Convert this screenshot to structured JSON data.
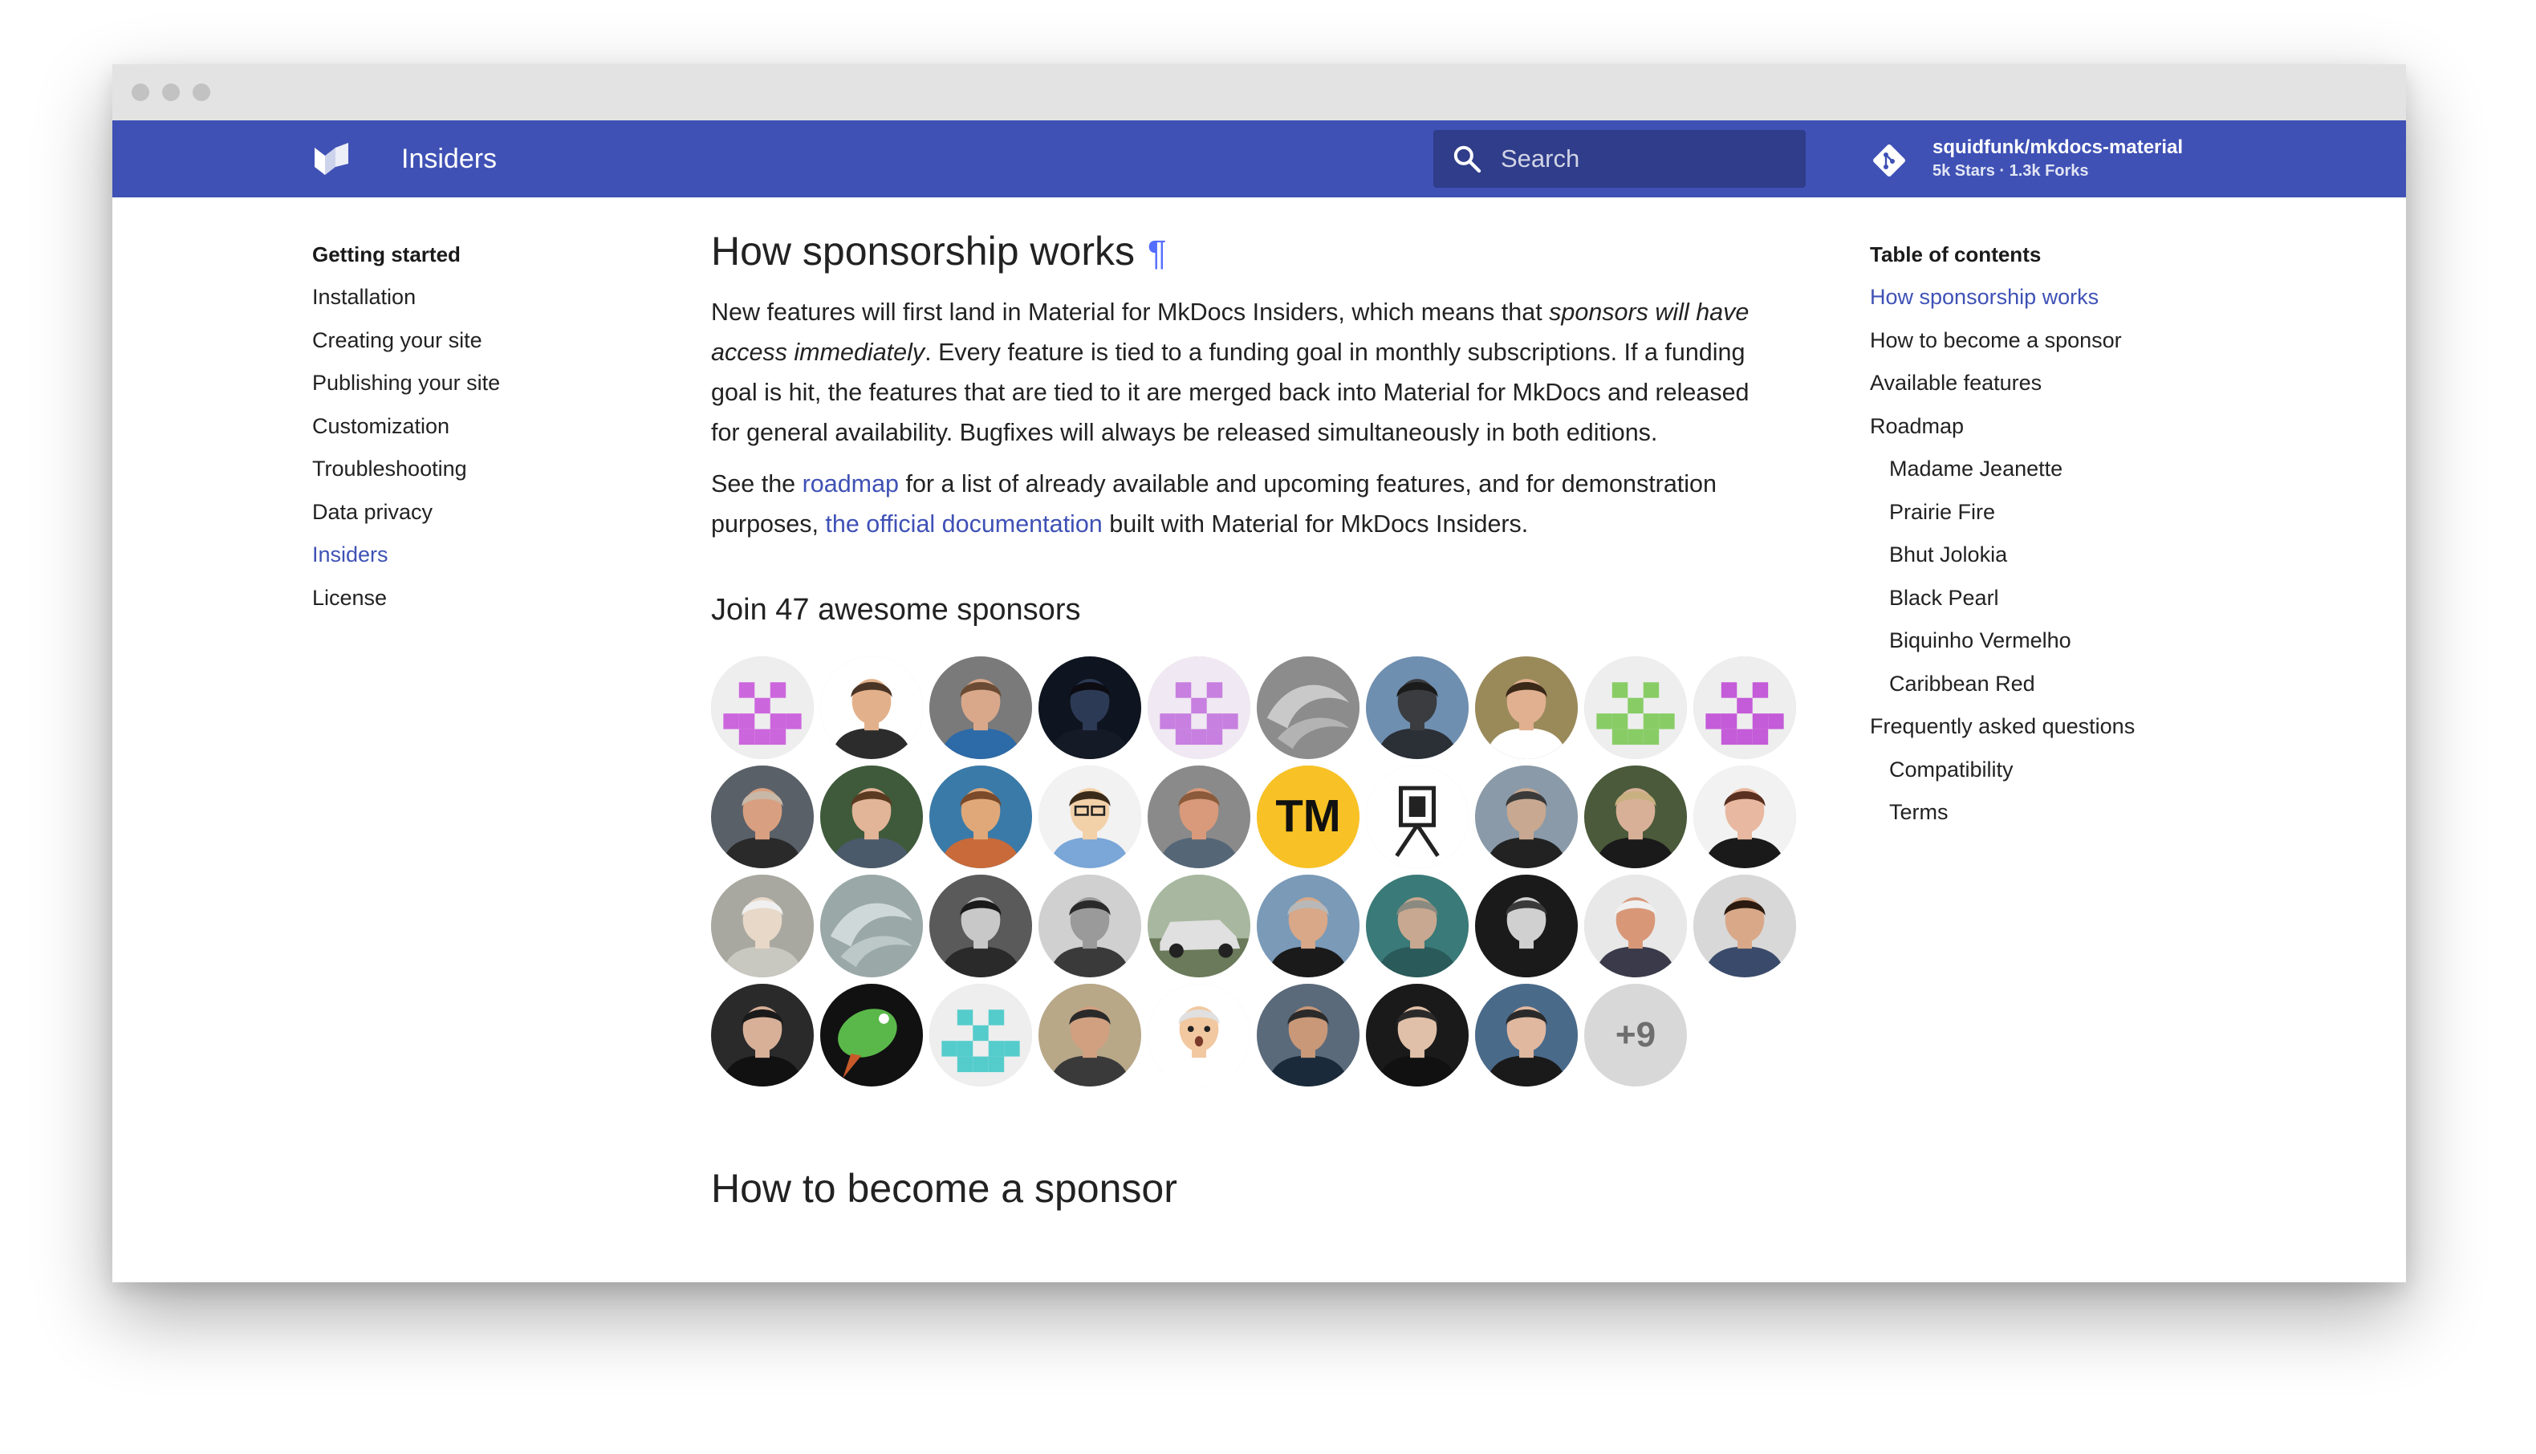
{
  "header": {
    "site_title": "Insiders",
    "search_placeholder": "Search",
    "repo_name": "squidfunk/mkdocs-material",
    "repo_stats": "5k Stars · 1.3k Forks",
    "color": "#3f51b5"
  },
  "sidebar": {
    "title": "Getting started",
    "items": [
      {
        "label": "Installation",
        "active": false
      },
      {
        "label": "Creating your site",
        "active": false
      },
      {
        "label": "Publishing your site",
        "active": false
      },
      {
        "label": "Customization",
        "active": false
      },
      {
        "label": "Troubleshooting",
        "active": false
      },
      {
        "label": "Data privacy",
        "active": false
      },
      {
        "label": "Insiders",
        "active": true
      },
      {
        "label": "License",
        "active": false
      }
    ]
  },
  "content": {
    "heading": "How sponsorship works",
    "headerlink": "¶",
    "paragraph1": {
      "line1_a": "New features will first land in Material for MkDocs Insiders, which means that ",
      "line1_em": "sponsors will have",
      "line2_em": "access immediately",
      "line2_b": ". Every feature is tied to a funding goal in monthly subscriptions. If a funding",
      "line3": "goal is hit, the features that are tied to it are merged back into Material for MkDocs and released",
      "line4": "for general availability. Bugfixes will always be released simultaneously in both editions."
    },
    "paragraph2": {
      "line1_a": "See the ",
      "link_roadmap": "roadmap",
      "line1_b": " for a list of already available and upcoming features, and for demonstration",
      "line2_a": "purposes, ",
      "link_docs": "the official documentation",
      "line2_b": " built with Material for MkDocs Insiders."
    },
    "sponsors_heading": "Join 47 awesome sponsors",
    "sponsors_more": "+9",
    "next_heading": "How to become a sponsor"
  },
  "sponsors": [
    {
      "name": "sponsor-1",
      "kind": "pixel",
      "bg": "#eeeeee",
      "fg": "#cc66dd"
    },
    {
      "name": "sponsor-2",
      "kind": "person",
      "bg": "#ffffff",
      "skin": "#e2b08a",
      "hair": "#4a3425",
      "shirt": "#2c2c2c"
    },
    {
      "name": "sponsor-3",
      "kind": "person",
      "bg": "#7a7a7a",
      "skin": "#d9a88a",
      "hair": "#6b4b33",
      "shirt": "#2d6aa8"
    },
    {
      "name": "sponsor-4",
      "kind": "person",
      "bg": "#0f1520",
      "skin": "#2d3a55",
      "hair": "#0c0c12",
      "shirt": "#141a26"
    },
    {
      "name": "sponsor-5",
      "kind": "pixel",
      "bg": "#f0e8f2",
      "fg": "#c77fe0"
    },
    {
      "name": "sponsor-6",
      "kind": "swirl",
      "bg": "#8c8c8c",
      "fg": "#d4d4d4"
    },
    {
      "name": "sponsor-7",
      "kind": "person",
      "bg": "#6f8fb0",
      "skin": "#3a3c40",
      "hair": "#1b1b1b",
      "shirt": "#2b2f36"
    },
    {
      "name": "sponsor-8",
      "kind": "person",
      "bg": "#9a8a5a",
      "skin": "#e0b090",
      "hair": "#3a2818",
      "shirt": "#ffffff"
    },
    {
      "name": "sponsor-9",
      "kind": "pixel",
      "bg": "#eeeeee",
      "fg": "#88cc66"
    },
    {
      "name": "sponsor-10",
      "kind": "pixel",
      "bg": "#eeeeee",
      "fg": "#c45bd8"
    },
    {
      "name": "sponsor-11",
      "kind": "person",
      "bg": "#5a6068",
      "skin": "#d8a080",
      "hair": "#c8b8a8",
      "shirt": "#2a2a2a"
    },
    {
      "name": "sponsor-12",
      "kind": "person",
      "bg": "#3e5a3a",
      "skin": "#e2b498",
      "hair": "#5a3a20",
      "shirt": "#4a5a6a"
    },
    {
      "name": "sponsor-13",
      "kind": "person",
      "bg": "#3a7aa8",
      "skin": "#e0a878",
      "hair": "#7a4a2a",
      "shirt": "#c86a3a"
    },
    {
      "name": "sponsor-14",
      "kind": "cartoon",
      "bg": "#f2f2f2",
      "skin": "#f2d0a8",
      "hair": "#3a2a1a",
      "shirt": "#7aa6d8"
    },
    {
      "name": "sponsor-15",
      "kind": "person",
      "bg": "#8a8a8a",
      "skin": "#d89a7a",
      "hair": "#8a5a3a",
      "shirt": "#556677"
    },
    {
      "name": "sponsor-16",
      "kind": "tm",
      "bg": "#f8c226",
      "fg": "#111111",
      "text": "TM"
    },
    {
      "name": "sponsor-17",
      "kind": "easel",
      "bg": "#ffffff",
      "fg": "#222222"
    },
    {
      "name": "sponsor-18",
      "kind": "person",
      "bg": "#8a9aa8",
      "skin": "#c8a890",
      "hair": "#3a3a3a",
      "shirt": "#222222"
    },
    {
      "name": "sponsor-19",
      "kind": "person",
      "bg": "#4a5a3a",
      "skin": "#d8b098",
      "hair": "#c8b080",
      "shirt": "#1a1a1a"
    },
    {
      "name": "sponsor-20",
      "kind": "person",
      "bg": "#f2f2f2",
      "skin": "#e8b8a0",
      "hair": "#5a3020",
      "shirt": "#1a1a1a"
    },
    {
      "name": "sponsor-21",
      "kind": "person",
      "bg": "#a8a8a0",
      "skin": "#e8d8c8",
      "hair": "#f0f0f0",
      "shirt": "#c8c8c0"
    },
    {
      "name": "sponsor-22",
      "kind": "swirl",
      "bg": "#9aa8a8",
      "fg": "#d8e0e0"
    },
    {
      "name": "sponsor-23",
      "kind": "person",
      "bg": "#5a5a5a",
      "skin": "#c8c8c8",
      "hair": "#1a1a1a",
      "shirt": "#2a2a2a"
    },
    {
      "name": "sponsor-24",
      "kind": "person",
      "bg": "#d0d0d0",
      "skin": "#9a9a9a",
      "hair": "#2a2a2a",
      "shirt": "#3a3a3a"
    },
    {
      "name": "sponsor-25",
      "kind": "car",
      "bg": "#a8b8a0",
      "fg": "#e0e0e0"
    },
    {
      "name": "sponsor-26",
      "kind": "person",
      "bg": "#7a9ab8",
      "skin": "#d8a888",
      "hair": "#b8b8b8",
      "shirt": "#1a1a1a"
    },
    {
      "name": "sponsor-27",
      "kind": "person",
      "bg": "#3a7a78",
      "skin": "#c8a890",
      "hair": "#8a8a80",
      "shirt": "#2a5a5a"
    },
    {
      "name": "sponsor-28",
      "kind": "person",
      "bg": "#1a1a1a",
      "skin": "#d0d0d0",
      "hair": "#3a3a3a",
      "shirt": "#1a1a1a"
    },
    {
      "name": "sponsor-29",
      "kind": "person",
      "bg": "#e8e8e8",
      "skin": "#d89878",
      "hair": "#f0f0f0",
      "shirt": "#3a3a4a"
    },
    {
      "name": "sponsor-30",
      "kind": "person",
      "bg": "#d8d8d8",
      "skin": "#d8a888",
      "hair": "#2a1a10",
      "shirt": "#3a4a6a"
    },
    {
      "name": "sponsor-31",
      "kind": "person",
      "bg": "#2a2a2a",
      "skin": "#d8b098",
      "hair": "#1a1a1a",
      "shirt": "#111111"
    },
    {
      "name": "sponsor-32",
      "kind": "bird",
      "bg": "#111111",
      "fg": "#5ab84a"
    },
    {
      "name": "sponsor-33",
      "kind": "pixel",
      "bg": "#eeeeee",
      "fg": "#55cccc"
    },
    {
      "name": "sponsor-34",
      "kind": "person",
      "bg": "#b8a888",
      "skin": "#d0a080",
      "hair": "#2a2a2a",
      "shirt": "#3a3a3a"
    },
    {
      "name": "sponsor-35",
      "kind": "emoji",
      "bg": "#ffffff",
      "skin": "#f2c8a0",
      "hair": "#e0e0e0",
      "shirt": "#ffffff"
    },
    {
      "name": "sponsor-36",
      "kind": "person",
      "bg": "#5a6a7a",
      "skin": "#c89878",
      "hair": "#2a2a2a",
      "shirt": "#1a2a3a"
    },
    {
      "name": "sponsor-37",
      "kind": "person",
      "bg": "#1a1a1a",
      "skin": "#e0c0a8",
      "hair": "#2a2a2a",
      "shirt": "#111111"
    },
    {
      "name": "sponsor-38",
      "kind": "person",
      "bg": "#4a6a8a",
      "skin": "#e0b8a0",
      "hair": "#2a2a2a",
      "shirt": "#1a1a1a"
    }
  ],
  "toc": {
    "title": "Table of contents",
    "items": [
      {
        "label": "How sponsorship works",
        "level": 1,
        "active": true
      },
      {
        "label": "How to become a sponsor",
        "level": 1,
        "active": false
      },
      {
        "label": "Available features",
        "level": 1,
        "active": false
      },
      {
        "label": "Roadmap",
        "level": 1,
        "active": false
      },
      {
        "label": "Madame Jeanette",
        "level": 2,
        "active": false
      },
      {
        "label": "Prairie Fire",
        "level": 2,
        "active": false
      },
      {
        "label": "Bhut Jolokia",
        "level": 2,
        "active": false
      },
      {
        "label": "Black Pearl",
        "level": 2,
        "active": false
      },
      {
        "label": "Biquinho Vermelho",
        "level": 2,
        "active": false
      },
      {
        "label": "Caribbean Red",
        "level": 2,
        "active": false
      },
      {
        "label": "Frequently asked questions",
        "level": 1,
        "active": false
      },
      {
        "label": "Compatibility",
        "level": 2,
        "active": false
      },
      {
        "label": "Terms",
        "level": 2,
        "active": false
      }
    ]
  }
}
